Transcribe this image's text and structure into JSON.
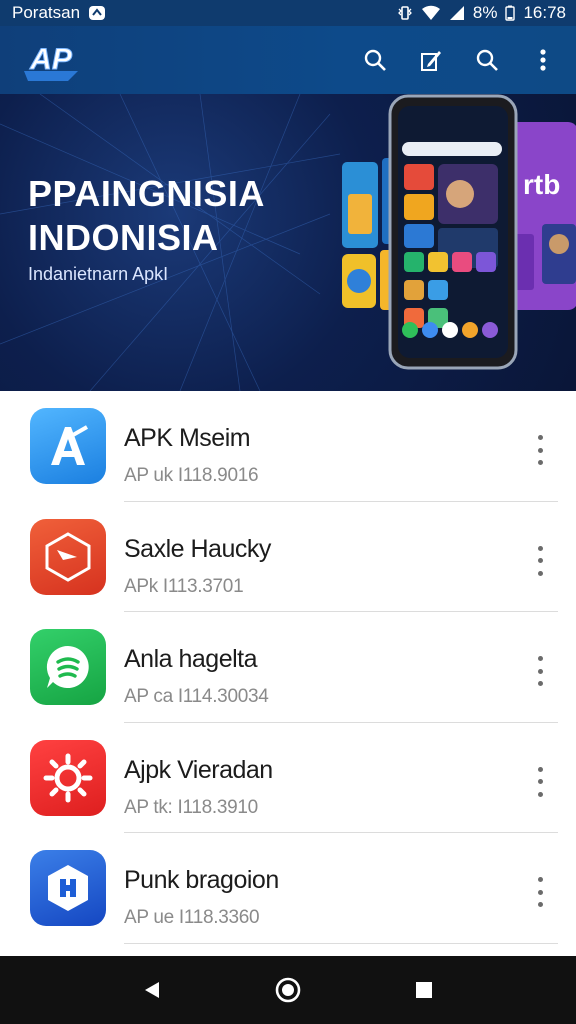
{
  "status_bar": {
    "carrier": "Poratsan",
    "battery": "8%",
    "time": "16:78"
  },
  "app_bar": {
    "logo_text": "AP",
    "actions": [
      "search-icon",
      "edit-icon",
      "search-icon",
      "more-vertical-icon"
    ]
  },
  "banner": {
    "title_line1": "PPAINGNISIA",
    "title_line2": "INDONISIA",
    "subtitle": "Indanietnarn ApkI",
    "side_text": "rtb"
  },
  "apps": [
    {
      "name": "APK Mseim",
      "sub": "AP uk I118.9016",
      "color": "#2f9cf0",
      "icon": "a-letter-icon"
    },
    {
      "name": "Saxle Haucky",
      "sub": "APk I113.3701",
      "color": "#e8452c",
      "icon": "play-arrow-icon"
    },
    {
      "name": "Anla hagelta",
      "sub": "AP ca I114.30034",
      "color": "#1fba4e",
      "icon": "chat-bubble-icon"
    },
    {
      "name": "Ajpk Vieradan",
      "sub": "AP tk: I118.3910",
      "color": "#ec2b2b",
      "icon": "sun-icon"
    },
    {
      "name": "Punk bragoion",
      "sub": "AP ue I118.3360",
      "color": "#1e5ed6",
      "icon": "hexagon-icon"
    }
  ],
  "colors": {
    "app_bar": "#0d4a8a",
    "status_bar": "#0f3b6e",
    "nav_bar": "#111111"
  }
}
